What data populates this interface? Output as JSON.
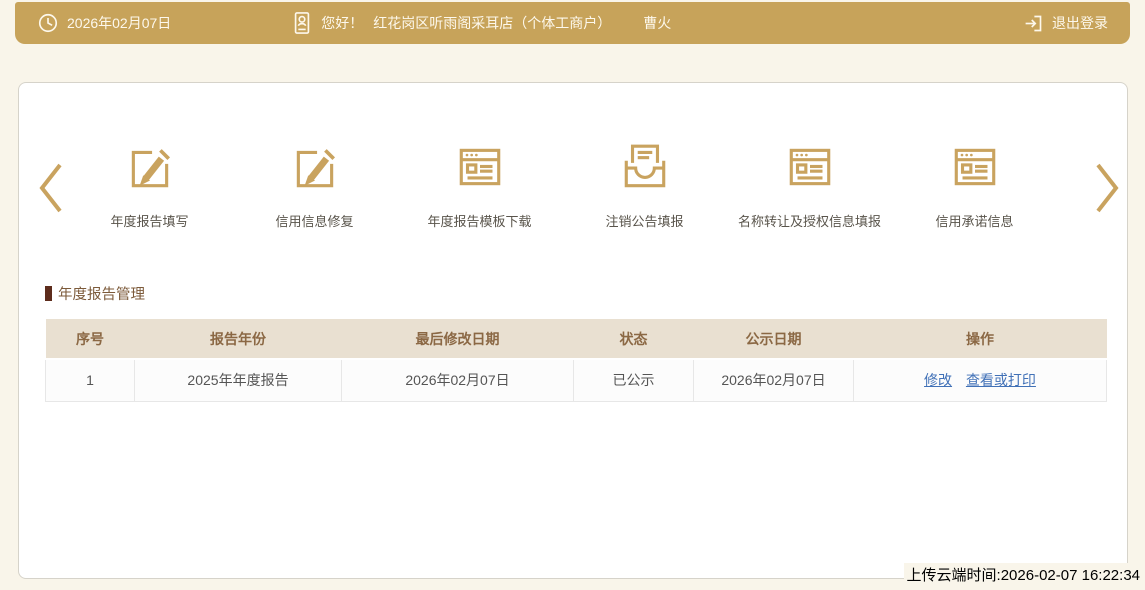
{
  "top_bar": {
    "date": "2026年02月07日",
    "greeting": "您好！",
    "company": "红花岗区听雨阁采耳店（个体工商户）",
    "user_name": "曹火",
    "logout_label": "退出登录"
  },
  "menu": {
    "items": [
      {
        "icon": "edit-icon",
        "label": "年度报告填写"
      },
      {
        "icon": "edit-icon",
        "label": "信用信息修复"
      },
      {
        "icon": "report-icon",
        "label": "年度报告模板下载"
      },
      {
        "icon": "inbox-icon",
        "label": "注销公告填报"
      },
      {
        "icon": "report-icon",
        "label": "名称转让及授权信息填报"
      },
      {
        "icon": "report-icon",
        "label": "信用承诺信息"
      }
    ]
  },
  "section": {
    "title": "年度报告管理"
  },
  "table": {
    "headers": [
      "序号",
      "报告年份",
      "最后修改日期",
      "状态",
      "公示日期",
      "操作"
    ],
    "rows": [
      {
        "index": "1",
        "report_year": "2025年年度报告",
        "last_modified": "2026年02月07日",
        "status": "已公示",
        "publish_date": "2026年02月07日",
        "actions": [
          "修改",
          "查看或打印"
        ]
      }
    ]
  },
  "footer": {
    "upload_time": "上传云端时间:2026-02-07 16:22:34"
  },
  "appearance": {
    "accent_gold": "#c7a35a",
    "icon_gold": "#c9a35f",
    "title_brown": "#7c5a3a",
    "marker_maroon": "#5d2c1c",
    "table_header_bg": "#e9e0d1",
    "table_header_text": "#8b6844",
    "link_blue": "#4171b7",
    "page_background": "#f9f5ea"
  }
}
